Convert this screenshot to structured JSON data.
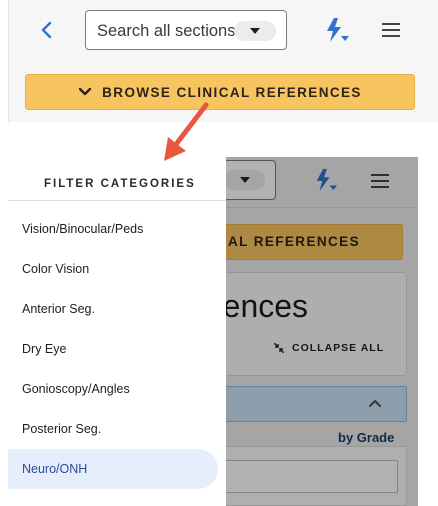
{
  "header": {
    "search": {
      "placeholder": "Search all sections"
    },
    "browse_label": "BROWSE CLINICAL REFERENCES",
    "icons": [
      "back-chevron-icon",
      "dropdown-caret-icon",
      "quick-actions-bolt-icon",
      "hamburger-menu-icon"
    ]
  },
  "background": {
    "browse_label_partial": "AL REFERENCES",
    "heading_partial": "rences",
    "collapse_all": "COLLAPSE ALL",
    "by_grade": "by Grade"
  },
  "drawer": {
    "title": "FILTER CATEGORIES",
    "categories": [
      {
        "label": "Vision/Binocular/Peds",
        "active": false
      },
      {
        "label": "Color Vision",
        "active": false
      },
      {
        "label": "Anterior Seg.",
        "active": false
      },
      {
        "label": "Dry Eye",
        "active": false
      },
      {
        "label": "Gonioscopy/Angles",
        "active": false
      },
      {
        "label": "Posterior Seg.",
        "active": false
      },
      {
        "label": "Neuro/ONH",
        "active": true
      }
    ]
  },
  "colors": {
    "accent_orange": "#f8c460",
    "accent_blue": "#2f74c9",
    "active_item_bg": "#e6eefb",
    "arrow_red": "#e8573f",
    "panel_blue": "#c9e2f5"
  }
}
